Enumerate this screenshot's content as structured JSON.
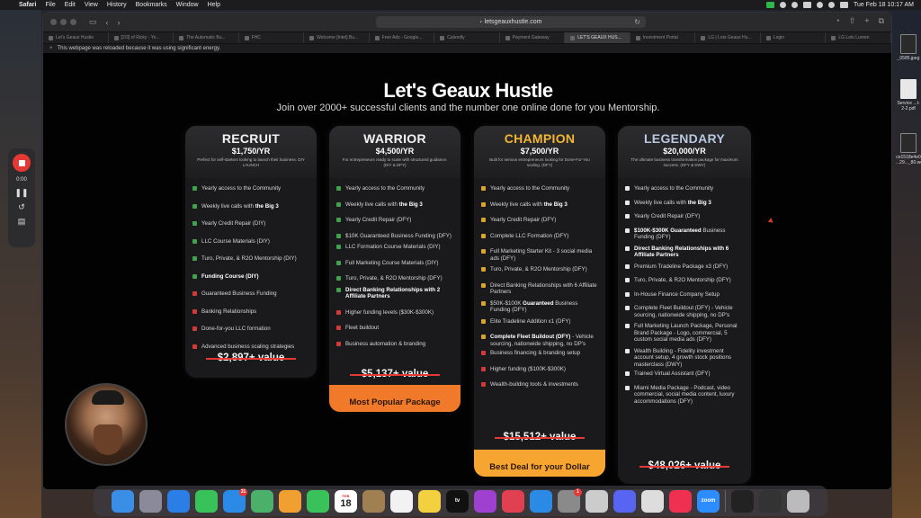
{
  "menubar": {
    "app": "Safari",
    "items": [
      "File",
      "Edit",
      "View",
      "History",
      "Bookmarks",
      "Window",
      "Help"
    ],
    "clock": "Tue Feb 18  10:17 AM"
  },
  "browser": {
    "url": "letsgeauxhustle.com",
    "notice": "This webpage was reloaded because it was using significant energy.",
    "tabs": [
      "Let's Geaux Hustle",
      "[2/3] of Ricky - Yo...",
      "The Automatic Bu...",
      "FHC",
      "Welcome [Intel] Bu...",
      "Free Ads - Google...",
      "Calendly",
      "Payment Gateway",
      "LET'S GEAUX HUS...",
      "Investment Portal",
      "LG | Lets Geaux Hu...",
      "Login",
      "LG Lets Lumen"
    ],
    "active_tab": 8
  },
  "page": {
    "title": "Let's Geaux Hustle",
    "subtitle": "Join over 2000+ successful clients and the number one online done for you Mentorship."
  },
  "plans": [
    {
      "tier": "RECRUIT",
      "price": "$1,750/YR",
      "desc": "Perfect for self-starters looking to launch their business. DIY LAUNCH",
      "color": "#f2f2f2",
      "value": "$2,897+ value",
      "banner": "",
      "items": [
        {
          "t": "Yearly access to the Community",
          "s": "ok"
        },
        {
          "t": "Weekly live calls with ",
          "b": "the Big 3",
          "s": "ok"
        },
        {
          "t": "Yearly Credit Repair (DIY)",
          "s": "ok"
        },
        {
          "t": "LLC Course Materials (DIY)",
          "s": "ok"
        },
        {
          "t": "Turo, Private, & R2O Mentorship (DIY)",
          "s": "ok"
        },
        {
          "t": "",
          "b": "Funding Course (DIY)",
          "s": "ok"
        },
        {
          "t": "Guaranteed Business Funding",
          "s": "no"
        },
        {
          "t": "Banking Relationships",
          "s": "no"
        },
        {
          "t": "Done-for-you LLC formation",
          "s": "no"
        },
        {
          "t": "Advanced business scaling strategies",
          "s": "no"
        }
      ]
    },
    {
      "tier": "WARRIOR",
      "price": "$4,500/YR",
      "desc": "For entrepreneurs ready to scale with structured guidance. (DIY & DFY)",
      "color": "#f2f2f2",
      "value": "$5,137+ value",
      "banner": "Most Popular Package",
      "items": [
        {
          "t": "Yearly access to the Community",
          "s": "ok"
        },
        {
          "t": "Weekly live calls with ",
          "b": "the Big 3",
          "s": "ok"
        },
        {
          "t": "Yearly Credit Repair (DFY)",
          "s": "ok"
        },
        {
          "t": "$10K Guaranteed Business Funding (DFY)",
          "s": "ok"
        },
        {
          "t": "LLC Formation Course Materials (DIY)",
          "s": "ok"
        },
        {
          "t": "Full Marketing Course Materials (DIY)",
          "s": "ok"
        },
        {
          "t": "Turo, Private, & R2O Mentorship (DFY)",
          "s": "ok"
        },
        {
          "t": "",
          "b": "Direct Banking Relationships with 2 Affiliate Partners",
          "s": "ok"
        },
        {
          "t": "Higher funding levels ($30K-$300K)",
          "s": "no"
        },
        {
          "t": "Fleet buildout",
          "s": "no"
        },
        {
          "t": "Business automation & branding",
          "s": "no"
        }
      ]
    },
    {
      "tier": "CHAMPION",
      "price": "$7,500/YR",
      "desc": "Built for serious entrepreneurs looking for Done-For-You scaling. (DFY)",
      "color": "#f2b632",
      "value": "$15,512+ value",
      "banner": "Best Deal for your Dollar",
      "items": [
        {
          "t": "Yearly access to the Community",
          "s": "gold"
        },
        {
          "t": "Weekly live calls with ",
          "b": "the Big 3",
          "s": "gold"
        },
        {
          "t": "Yearly Credit Repair (DFY)",
          "s": "gold"
        },
        {
          "t": "Complete LLC Formation (DFY)",
          "s": "gold"
        },
        {
          "t": "Full Marketing Starter Kit - 3 social media ads (DFY)",
          "s": "gold"
        },
        {
          "t": "Turo, Private, & R2O Mentorship (DFY)",
          "s": "gold"
        },
        {
          "t": "Direct Banking Relationships with 6 Affiliate Partners",
          "s": "gold"
        },
        {
          "t": "$50K-$100K ",
          "b": "Guaranteed",
          "t2": " Business Funding (DFY)",
          "s": "gold"
        },
        {
          "t": "Elite  Tradeline Addition x1 (DFY)",
          "s": "gold"
        },
        {
          "t": "",
          "b": "Complete Fleet Buildout (DFY)",
          "t2": " - Vehicle sourcing, nationwide shipping, no DP's",
          "s": "gold"
        },
        {
          "t": "Business financing & branding setup",
          "s": "no"
        },
        {
          "t": "Higher funding ($100K-$300K)",
          "s": "no"
        },
        {
          "t": "Wealth-building tools & investments",
          "s": "no"
        }
      ]
    },
    {
      "tier": "LEGENDARY",
      "price": "$20,000/YR",
      "desc": "The ultimate business transformation package for maximum success. (DFY & DWY)",
      "color": "#b9c8e0",
      "value": "$48,026+ value",
      "banner": "",
      "items": [
        {
          "t": "Yearly access to the Community",
          "s": "white"
        },
        {
          "t": "Weekly live calls with ",
          "b": "the Big 3",
          "s": "white"
        },
        {
          "t": "Yearly Credit Repair (DFY)",
          "s": "white"
        },
        {
          "t": "",
          "b": "$100K-$300K Guaranteed",
          "t2": " Business Funding (DFY)",
          "s": "white"
        },
        {
          "t": "",
          "b": "Direct Banking Relationships with 6 Affiliate Partners",
          "s": "white"
        },
        {
          "t": "Premium Tradeline Package x3 (DFY)",
          "s": "white"
        },
        {
          "t": "Turo, Private, & R2O Mentorship (DFY)",
          "s": "white"
        },
        {
          "t": "In-House Finance Company Setup",
          "s": "white"
        },
        {
          "t": "Complete Fleet Buildout (DFY) - Vehicle sourcing, nationwide shipping, no DP's",
          "s": "white"
        },
        {
          "t": "Full Marketing Launch Package, Personal Brand Package - Logo, commercial, 5 custom social media ads (DFY)",
          "s": "white"
        },
        {
          "t": "Wealth Building - Fidelity investment account setup, 4 growth stock positions masterclass (DWY)",
          "s": "white"
        },
        {
          "t": "Trained Virtual Assistant (DFY)",
          "s": "white"
        },
        {
          "t": "Miami Media Package - Podcast, video commercial, social media content, luxury accommodations (DFY)",
          "s": "white"
        }
      ]
    }
  ],
  "recorder": {
    "time": "0:00"
  },
  "desktop": {
    "files": [
      "_0585.jpeg",
      "Service ...t-2-2.pdf",
      "ce1518e4e0 ...29..._80.webp"
    ]
  },
  "dock": {
    "apps": [
      "Finder",
      "Launchpad",
      "Safari",
      "Messages",
      "Mail",
      "Maps",
      "Photos",
      "FaceTime",
      "Calendar",
      "Notes-Brown",
      "Reminders",
      "Notes",
      "TV",
      "Podcasts",
      "News",
      "App Store",
      "System Settings",
      "Preview",
      "Discord",
      "Preview2",
      "Music",
      "Zoom",
      "Screenshot",
      "Recent",
      "Trash"
    ],
    "calendar_day": "18",
    "calendar_month": "FEB",
    "mail_badge": "31",
    "settings_badge": "1",
    "tv_label": "tv",
    "zoom_label": "zoom"
  }
}
